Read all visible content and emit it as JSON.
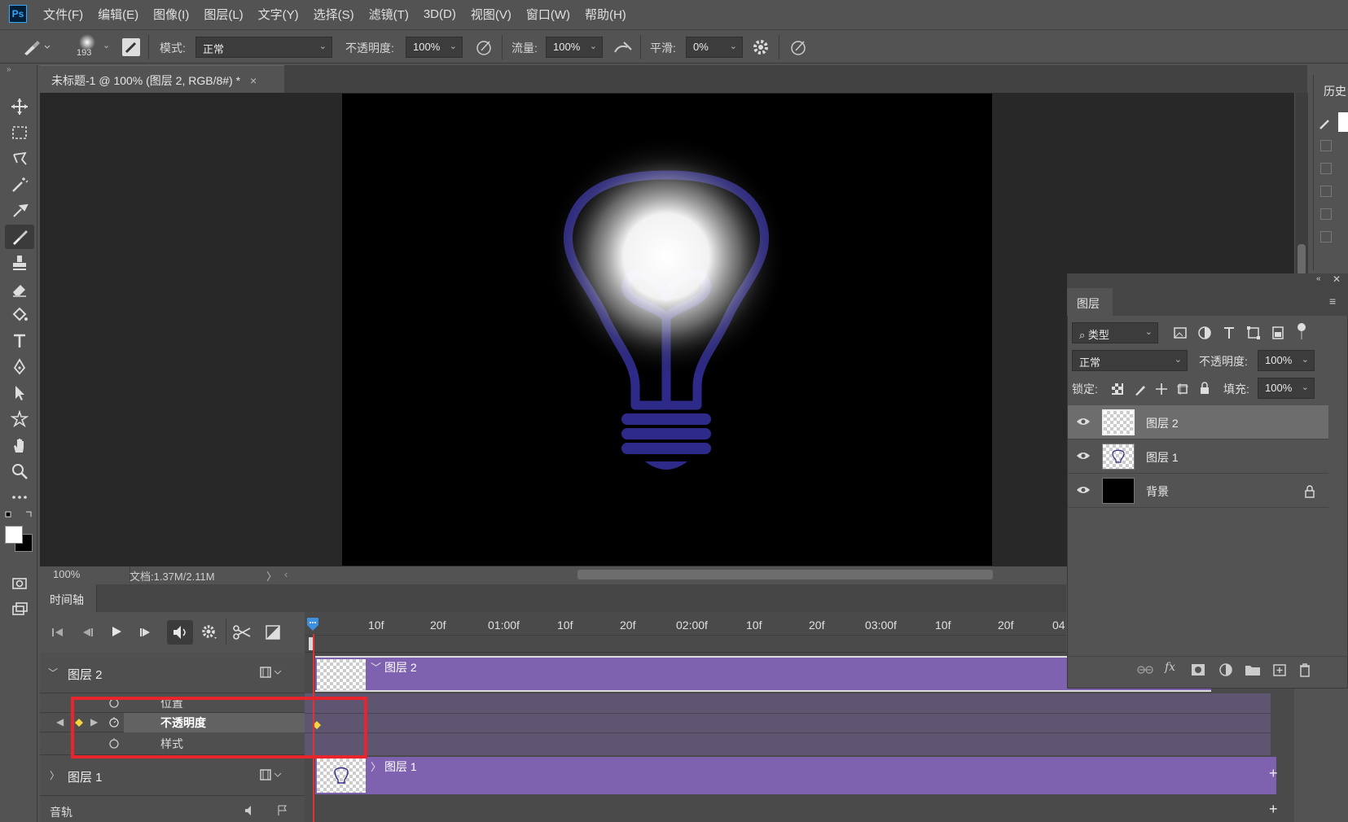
{
  "menubar": {
    "logo": "Ps",
    "items": [
      "文件(F)",
      "编辑(E)",
      "图像(I)",
      "图层(L)",
      "文字(Y)",
      "选择(S)",
      "滤镜(T)",
      "3D(D)",
      "视图(V)",
      "窗口(W)",
      "帮助(H)"
    ]
  },
  "options": {
    "brush_size": "193",
    "mode_label": "模式:",
    "mode_value": "正常",
    "opacity_label": "不透明度:",
    "opacity_value": "100%",
    "flow_label": "流量:",
    "flow_value": "100%",
    "smooth_label": "平滑:",
    "smooth_value": "0%"
  },
  "document": {
    "tab_title": "未标题-1 @ 100% (图层 2, RGB/8#) *",
    "zoom": "100%",
    "doc_info": "文档:1.37M/2.11M"
  },
  "timeline": {
    "tab": "时间轴",
    "ruler_ticks": [
      "10f",
      "20f",
      "01:00f",
      "10f",
      "20f",
      "02:00f",
      "10f",
      "20f",
      "03:00f",
      "10f",
      "20f",
      "04"
    ],
    "layer2": "图层 2",
    "prop_position": "位置",
    "prop_opacity": "不透明度",
    "prop_style": "样式",
    "layer1": "图层 1",
    "audio": "音轨",
    "track_layer2": "图层 2",
    "track_layer1": "图层 1"
  },
  "history_panel": {
    "title": "历史"
  },
  "layers_panel": {
    "tab": "图层",
    "filter_label": "类型",
    "blend_mode": "正常",
    "opacity_label": "不透明度:",
    "opacity_value": "100%",
    "lock_label": "锁定:",
    "fill_label": "填充:",
    "fill_value": "100%",
    "layers": [
      {
        "name": "图层 2",
        "selected": true
      },
      {
        "name": "图层 1",
        "selected": false
      },
      {
        "name": "背景",
        "selected": false,
        "locked": true
      }
    ]
  },
  "colors": {
    "bulb_stroke": "#2e2a8a",
    "track_purple": "#7e62b0",
    "highlight_red": "#e8252d",
    "keyframe_yellow": "#f5d442"
  }
}
